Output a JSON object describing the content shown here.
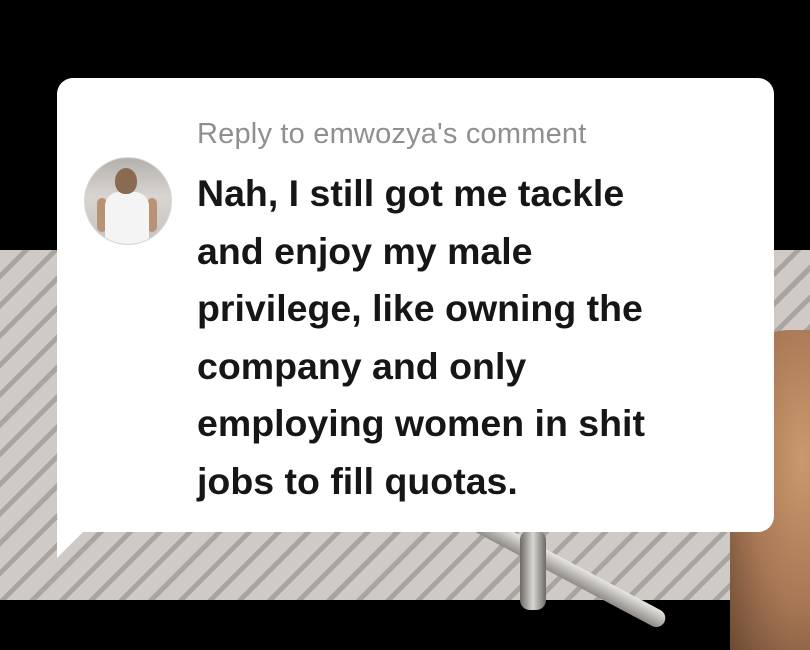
{
  "comment": {
    "reply_header": "Reply to emwozya's comment",
    "lines": [
      "Nah, I still got me tackle",
      "and enjoy my male",
      "privilege, like owning the",
      "company and only",
      "employing women in shit",
      "jobs to fill quotas."
    ],
    "avatar_icon": "user-avatar"
  },
  "colors": {
    "bubble": "#ffffff",
    "header_text": "#8f8f8f",
    "body_text": "#161616",
    "top_band": "#000000"
  }
}
